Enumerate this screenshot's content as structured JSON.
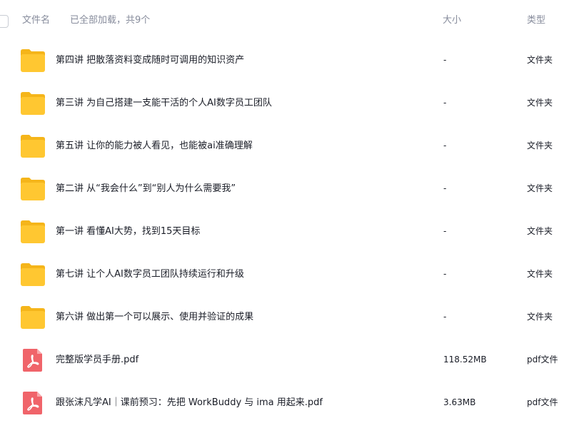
{
  "header": {
    "name_label": "文件名",
    "status": "已全部加载，共9个",
    "size_label": "大小",
    "type_label": "类型"
  },
  "colors": {
    "folder": "#ffc731",
    "folder_tab": "#f5b51a",
    "pdf": "#f0646a",
    "text": "#1a1d27",
    "muted": "#878c9c"
  },
  "items": [
    {
      "name": "第四讲 把散落资料变成随时可调用的知识资产",
      "size": "-",
      "type": "文件夹",
      "icon": "folder-icon"
    },
    {
      "name": "第三讲 为自己搭建一支能干活的个人AI数字员工团队",
      "size": "-",
      "type": "文件夹",
      "icon": "folder-icon"
    },
    {
      "name": "第五讲 让你的能力被人看见，也能被ai准确理解",
      "size": "-",
      "type": "文件夹",
      "icon": "folder-icon"
    },
    {
      "name": "第二讲 从“我会什么”到“别人为什么需要我”",
      "size": "-",
      "type": "文件夹",
      "icon": "folder-icon"
    },
    {
      "name": "第一讲 看懂AI大势，找到15天目标",
      "size": "-",
      "type": "文件夹",
      "icon": "folder-icon"
    },
    {
      "name": "第七讲 让个人AI数字员工团队持续运行和升级",
      "size": "-",
      "type": "文件夹",
      "icon": "folder-icon"
    },
    {
      "name": "第六讲 做出第一个可以展示、使用并验证的成果",
      "size": "-",
      "type": "文件夹",
      "icon": "folder-icon"
    },
    {
      "name": "完整版学员手册.pdf",
      "size": "118.52MB",
      "type": "pdf文件",
      "icon": "pdf-icon"
    },
    {
      "name": "跟张沫凡学AI｜课前预习：先把 WorkBuddy 与 ima 用起来.pdf",
      "size": "3.63MB",
      "type": "pdf文件",
      "icon": "pdf-icon"
    }
  ]
}
